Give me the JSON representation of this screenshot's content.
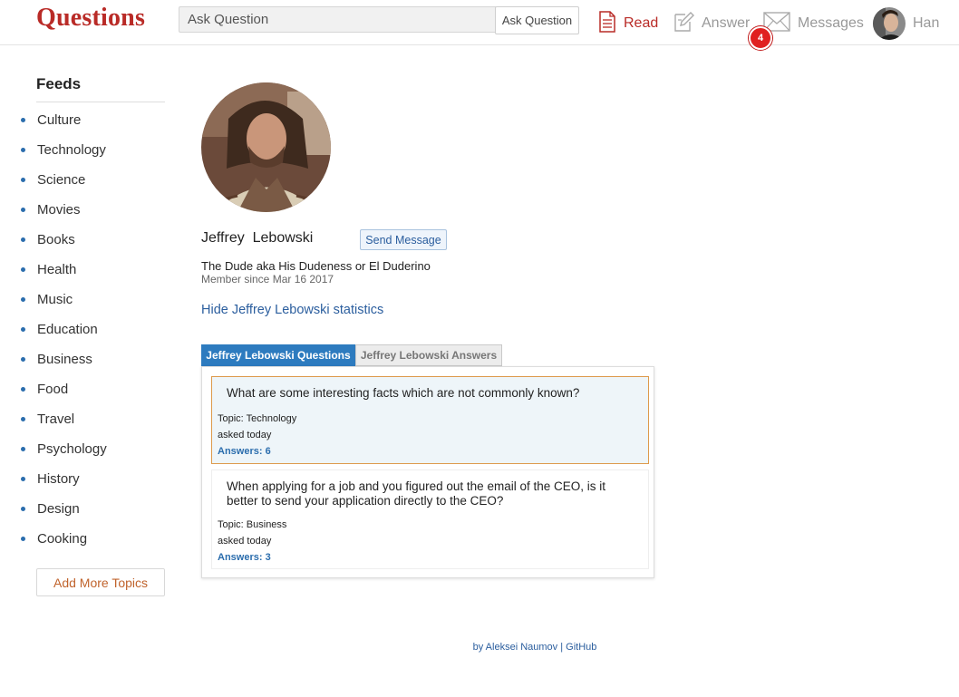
{
  "header": {
    "logo": "Questions",
    "search_placeholder": "Ask Question",
    "ask_button": "Ask Question",
    "nav": {
      "read": "Read",
      "answer": "Answer",
      "messages": "Messages",
      "messages_badge": "4",
      "user": "Han"
    },
    "accent_color": "#b92b27"
  },
  "sidebar": {
    "title": "Feeds",
    "items": [
      "Culture",
      "Technology",
      "Science",
      "Movies",
      "Books",
      "Health",
      "Music",
      "Education",
      "Business",
      "Food",
      "Travel",
      "Psychology",
      "History",
      "Design",
      "Cooking"
    ],
    "add_button": "Add More Topics"
  },
  "profile": {
    "first_name": "Jeffrey",
    "last_name": "Lebowski",
    "send_message": "Send Message",
    "bio": "The Dude aka His Dudeness or El Duderino",
    "member_since": "Member since Mar 16 2017",
    "hide_stats": "Hide Jeffrey Lebowski statistics"
  },
  "tabs": {
    "questions": "Jeffrey Lebowski Questions",
    "answers": "Jeffrey Lebowski Answers",
    "active": "questions"
  },
  "questions": [
    {
      "title": "What are some interesting facts which are not commonly known?",
      "topic": "Topic: Technology",
      "asked": "asked today",
      "answers": "Answers: 6"
    },
    {
      "title": "When applying for a job and you figured out the email of the CEO, is it better to send your application directly to the CEO?",
      "topic": "Topic: Business",
      "asked": "asked today",
      "answers": "Answers: 3"
    }
  ],
  "footer": {
    "by": "by Aleksei Naumov",
    "sep": " | ",
    "github": "GitHub"
  }
}
